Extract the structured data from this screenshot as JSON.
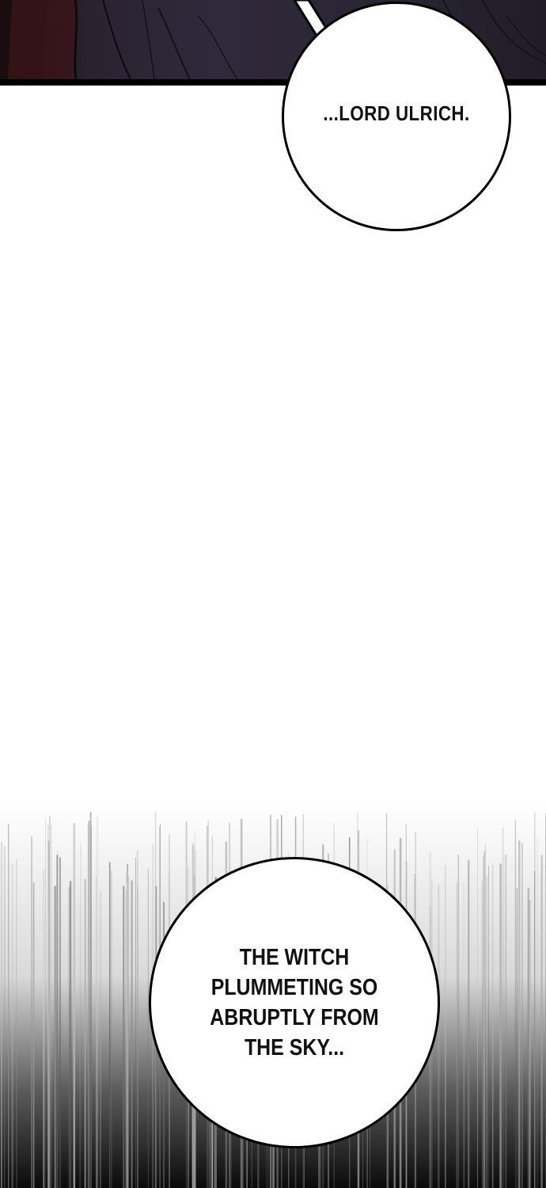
{
  "bubbles": {
    "top": {
      "text": "...LORD ULRICH."
    },
    "bottom": {
      "lines": [
        "THE WITCH",
        "PLUMMETING SO",
        "ABRUPTLY FROM",
        "THE SKY..."
      ]
    }
  },
  "colors": {
    "panel_dark": "#2f2a3b",
    "ink": "#000000",
    "paper": "#ffffff"
  }
}
